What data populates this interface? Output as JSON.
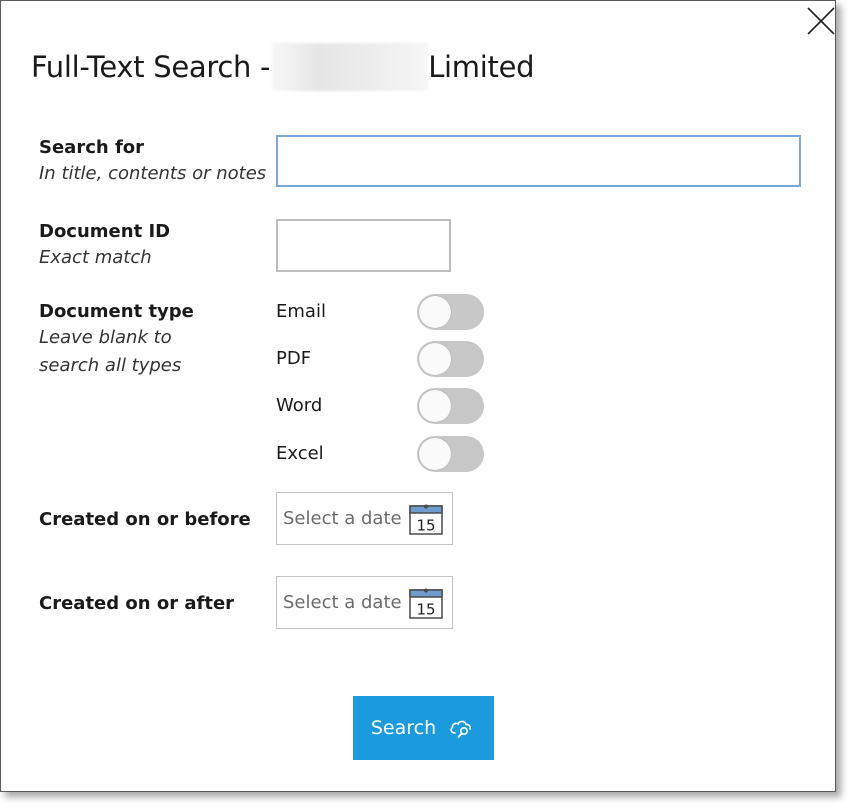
{
  "dialog": {
    "title_prefix": "Full-Text Search -",
    "title_suffix": "Limited"
  },
  "fields": {
    "search_for": {
      "label": "Search for",
      "hint": "In title, contents or notes",
      "value": ""
    },
    "document_id": {
      "label": "Document ID",
      "hint": "Exact match",
      "value": ""
    },
    "document_type": {
      "label": "Document type",
      "hint_line1": "Leave blank to",
      "hint_line2": "search all types",
      "options": [
        {
          "label": "Email",
          "on": false
        },
        {
          "label": "PDF",
          "on": false
        },
        {
          "label": "Word",
          "on": false
        },
        {
          "label": "Excel",
          "on": false
        }
      ]
    },
    "created_before": {
      "label": "Created on or before",
      "placeholder": "Select a date"
    },
    "created_after": {
      "label": "Created on or after",
      "placeholder": "Select a date"
    }
  },
  "calendar_icon_day": "15",
  "search_button": {
    "label": "Search"
  },
  "colors": {
    "accent": "#1b9bdd",
    "focus_border": "#7aa8d8",
    "toggle_off": "#c7c7c7"
  },
  "icons": {
    "close": "close-icon",
    "calendar": "calendar-icon",
    "search": "search-cloud-icon"
  }
}
